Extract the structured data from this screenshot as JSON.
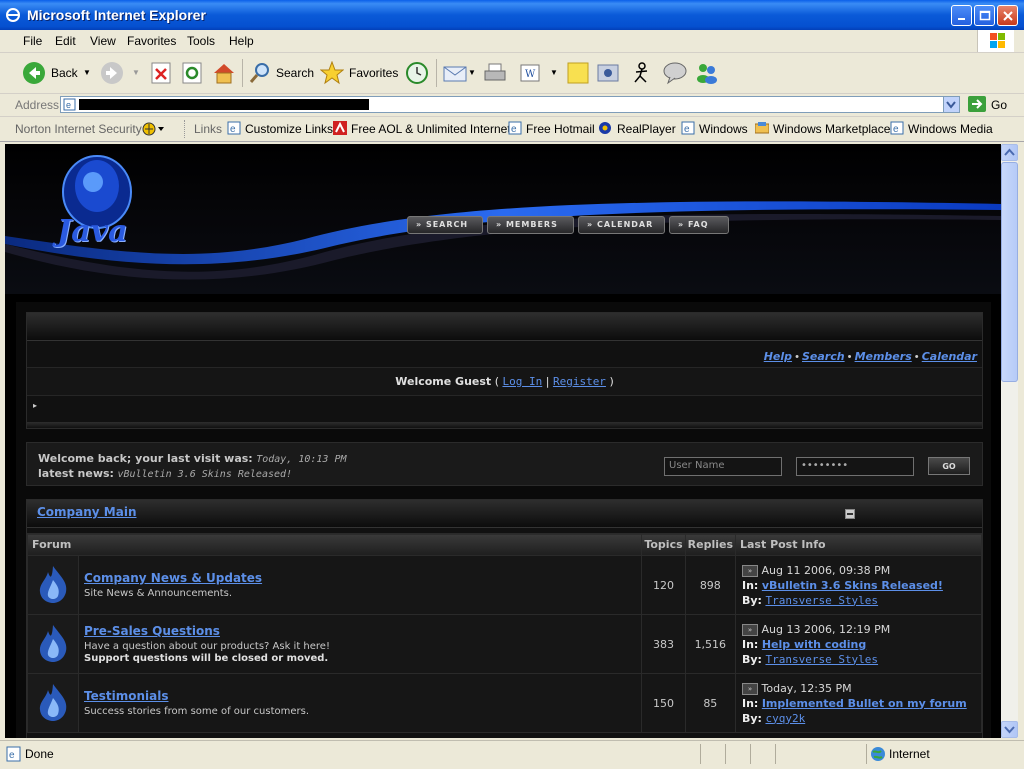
{
  "window": {
    "title": "Microsoft Internet Explorer"
  },
  "menu": [
    "File",
    "Edit",
    "View",
    "Favorites",
    "Tools",
    "Help"
  ],
  "toolbar": {
    "back": "Back",
    "search": "Search",
    "favorites": "Favorites"
  },
  "address": {
    "label": "Address",
    "go": "Go"
  },
  "links_bar": {
    "norton": "Norton Internet Security",
    "links_label": "Links",
    "items": [
      "Customize Links",
      "Free AOL & Unlimited Internet",
      "Free Hotmail",
      "RealPlayer",
      "Windows",
      "Windows Marketplace",
      "Windows Media"
    ]
  },
  "site": {
    "logo_text": "Java",
    "nav": [
      "SEARCH",
      "MEMBERS",
      "CALENDAR",
      "FAQ"
    ],
    "top_links": [
      "Help",
      "Search",
      "Members",
      "Calendar"
    ],
    "welcome": {
      "prefix": "Welcome Guest",
      "open": "(",
      "login": "Log In",
      "pipe": "|",
      "register": "Register",
      "close": ")"
    },
    "last_visit": {
      "label": "Welcome back; your last visit was:",
      "value": "Today, 10:13 PM"
    },
    "news": {
      "label": "latest news:",
      "value": "vBulletin 3.6 Skins Released!"
    },
    "login_form": {
      "username_placeholder": "User Name",
      "password_value": "••••••••",
      "go": "GO"
    },
    "category": "Company Main",
    "headers": {
      "forum": "Forum",
      "topics": "Topics",
      "replies": "Replies",
      "last_post": "Last Post Info"
    },
    "rows": [
      {
        "name": "Company News & Updates",
        "desc": "Site News & Announcements.",
        "desc2": "",
        "topics": "120",
        "replies": "898",
        "date": "Aug 11 2006, 09:38 PM",
        "in_label": "In:",
        "in_thread": "vBulletin 3.6 Skins Released!",
        "by_label": "By:",
        "by_user": "Transverse Styles"
      },
      {
        "name": "Pre-Sales Questions",
        "desc": "Have a question about our products? Ask it here!",
        "desc2": "Support questions will be closed or moved.",
        "topics": "383",
        "replies": "1,516",
        "date": "Aug 13 2006, 12:19 PM",
        "in_label": "In:",
        "in_thread": "Help with coding",
        "by_label": "By:",
        "by_user": "Transverse Styles"
      },
      {
        "name": "Testimonials",
        "desc": "Success stories from some of our customers.",
        "desc2": "",
        "topics": "150",
        "replies": "85",
        "date": "Today, 12:35 PM",
        "in_label": "In:",
        "in_thread": "Implemented Bullet on my forum",
        "by_label": "By:",
        "by_user": "cyqy2k"
      }
    ]
  },
  "status": {
    "text": "Done",
    "zone": "Internet"
  }
}
